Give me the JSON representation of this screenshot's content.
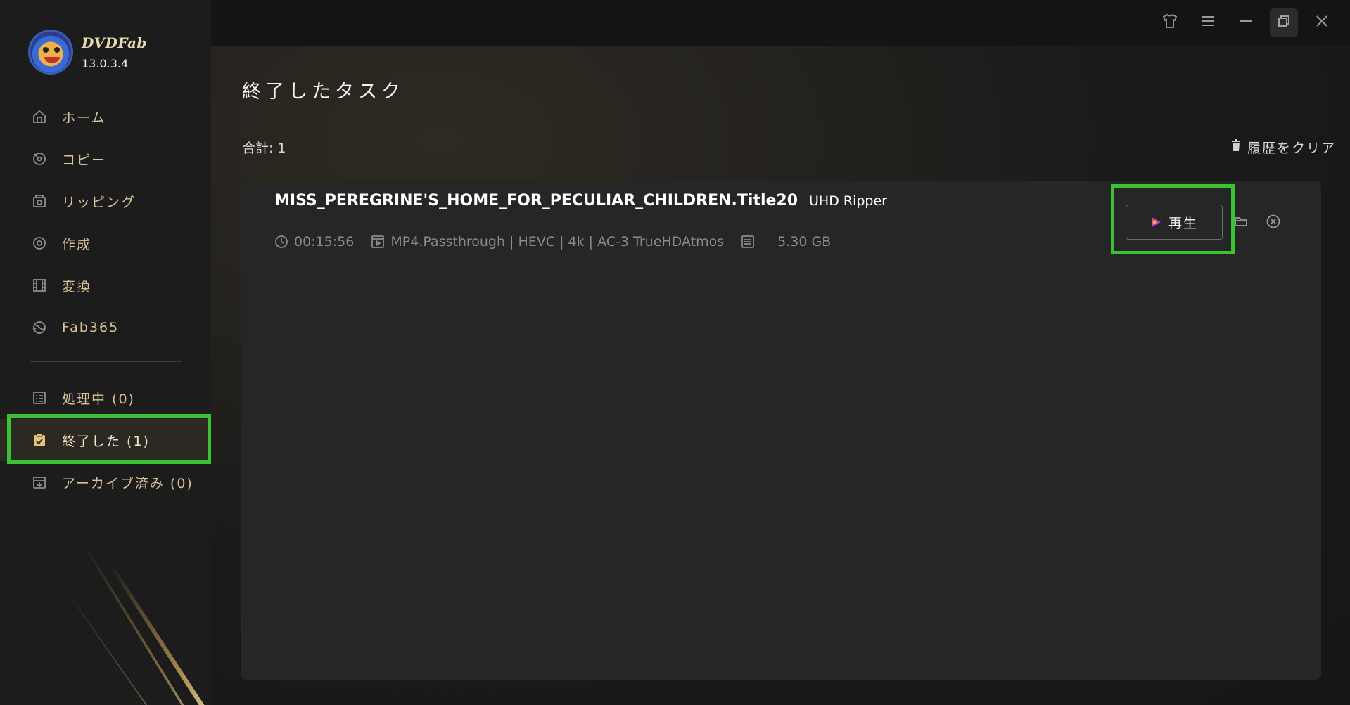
{
  "app": {
    "brand": "DVDFab",
    "version": "13.0.3.4"
  },
  "sidebar": {
    "nav": [
      {
        "label": "ホーム",
        "icon": "home-icon"
      },
      {
        "label": "コピー",
        "icon": "disc-copy-icon"
      },
      {
        "label": "リッピング",
        "icon": "ripper-icon"
      },
      {
        "label": "作成",
        "icon": "creator-icon"
      },
      {
        "label": "変換",
        "icon": "film-convert-icon"
      },
      {
        "label": "Fab365",
        "icon": "fab365-icon"
      }
    ],
    "tasks": [
      {
        "label": "処理中 (0)",
        "icon": "task-list-icon",
        "active": false
      },
      {
        "label": "終了した (1)",
        "icon": "clipboard-check-icon",
        "active": true
      },
      {
        "label": "アーカイブ済み (0)",
        "icon": "archive-icon",
        "active": false
      }
    ]
  },
  "window": {
    "controls": [
      "shirt-skin-icon",
      "menu-icon",
      "minimize-icon",
      "restore-icon",
      "close-icon"
    ]
  },
  "main": {
    "title": "終了したタスク",
    "total": "合計: 1",
    "clear_history": "履歴をクリア",
    "task": {
      "name": "MISS_PEREGRINE'S_HOME_FOR_PECULIAR_CHILDREN.Title20",
      "tag": "UHD Ripper",
      "duration": "00:15:56",
      "format": "MP4.Passthrough | HEVC | 4k | AC-3 TrueHDAtmos",
      "size": "5.30 GB",
      "play_label": "再生"
    }
  },
  "colors": {
    "accent_highlight": "#39c42f",
    "nav_text": "#d8c49a",
    "background": "#141414"
  }
}
